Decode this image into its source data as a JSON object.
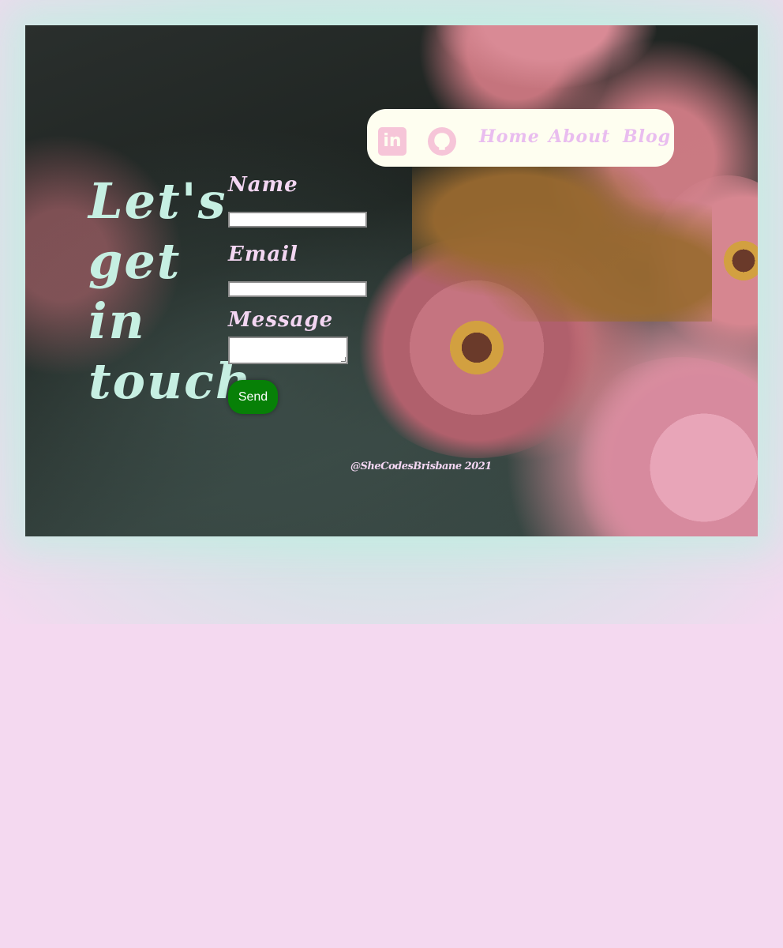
{
  "nav": {
    "linkedin_icon": "linkedin-icon",
    "linkedin_glyph": "in",
    "github_icon": "github-icon",
    "links": [
      "Home",
      "About",
      "Blog"
    ]
  },
  "hero": {
    "title_lines": [
      "Let's",
      "get",
      "in",
      "touch"
    ]
  },
  "form": {
    "name_label": "Name",
    "name_value": "",
    "email_label": "Email",
    "email_value": "",
    "message_label": "Message",
    "message_value": "",
    "send_label": "Send"
  },
  "footer": {
    "text": "@SheCodesBrisbane 2021"
  },
  "colors": {
    "background": "#f4d9f0",
    "title": "#c6efe2",
    "label": "#f3d6f2",
    "nav_bg": "#fefef0",
    "nav_link": "#e9bdef",
    "icon": "#f6c5d8",
    "send_button": "#078007"
  }
}
